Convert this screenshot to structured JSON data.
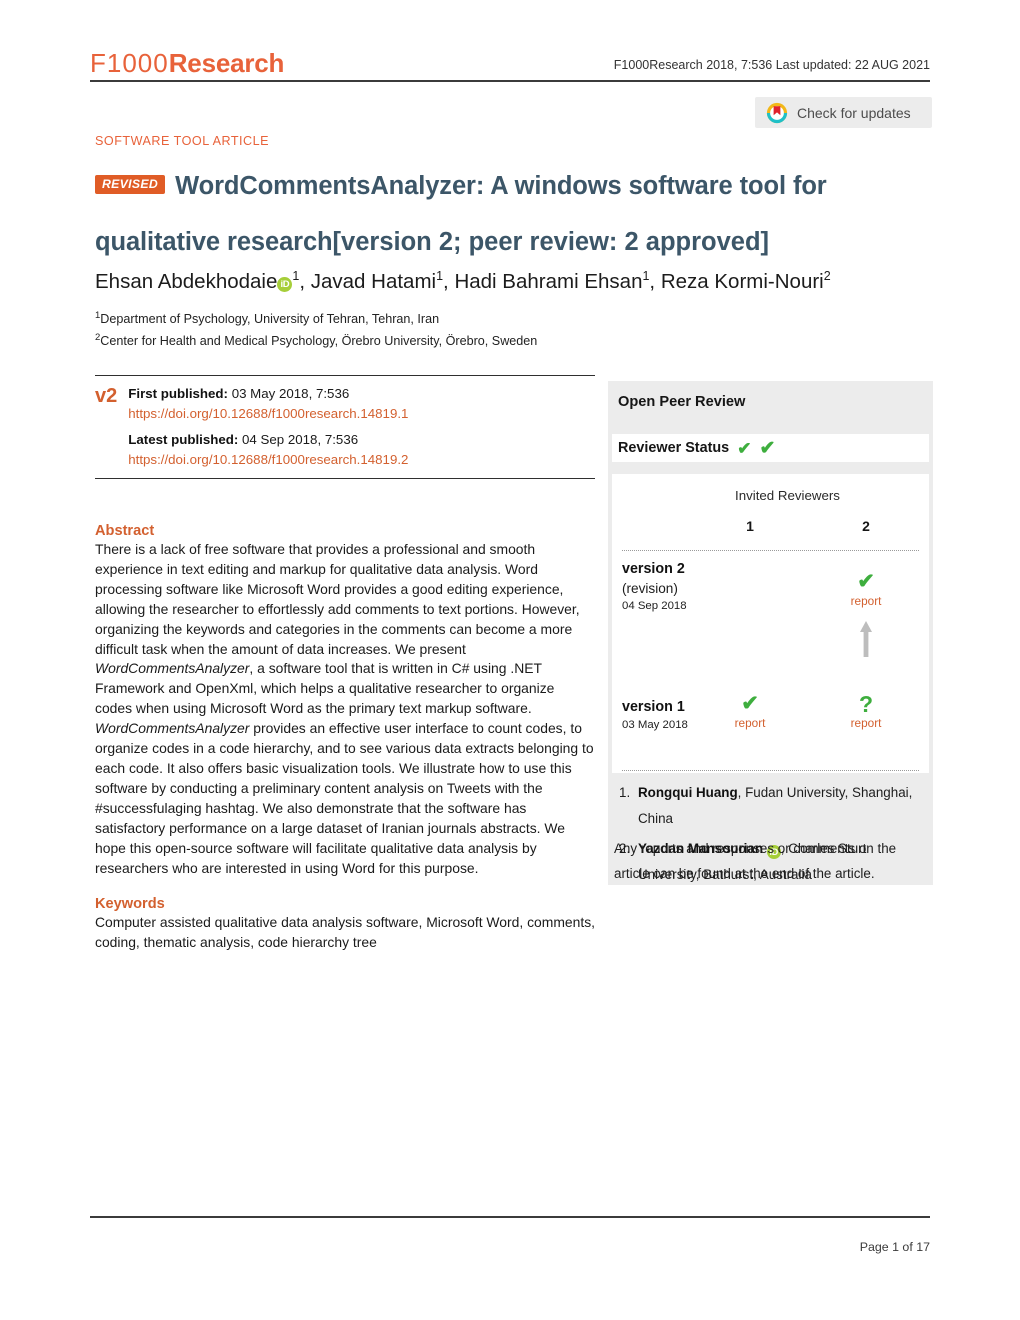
{
  "header": {
    "logo_thin": "F1000",
    "logo_bold": "Research",
    "meta": "F1000Research 2018, 7:536 Last updated: 22 AUG 2021",
    "crossmark_label": "Check for updates",
    "crossmark_icon": "crossmark-circle-bookmark-icon"
  },
  "article": {
    "type": "SOFTWARE TOOL ARTICLE",
    "revised_badge": "REVISED",
    "title_line1": "WordCommentsAnalyzer: A windows software tool for",
    "title_line2": "qualitative research",
    "title_version": "[version 2; peer review: 2 approved]",
    "authors_html": "Ehsan Abdekhodaie<ORCID><sup>1</sup>, Javad Hatami<sup>1</sup>, Hadi Bahrami Ehsan<sup>1</sup>, Reza Kormi-Nouri<sup>2</sup>",
    "affiliations": [
      {
        "marker": "1",
        "text": "Department of Psychology, University of Tehran, Tehran, Iran"
      },
      {
        "marker": "2",
        "text": "Center for Health and Medical Psychology, Örebro University, Örebro, Sweden"
      }
    ]
  },
  "publication": {
    "version_tag": "v2",
    "first_published_label": "First published:",
    "first_published_value": "03 May 2018, 7:536",
    "first_published_doi": "https://doi.org/10.12688/f1000research.14819.1",
    "latest_published_label": "Latest published:",
    "latest_published_value": "04 Sep 2018, 7:536",
    "latest_published_doi": "https://doi.org/10.12688/f1000research.14819.2"
  },
  "abstract": {
    "heading": "Abstract",
    "paragraph": "There is a lack of free software that provides a professional and smooth experience in text editing and markup for qualitative data analysis. Word processing software like Microsoft Word provides a good editing experience, allowing the researcher to effortlessly add comments to text portions. However, organizing the keywords and categories in the comments can become a more difficult task when the amount of data increases. We present WordCommentsAnalyzer, a software tool that is written in C# using .NET Framework and OpenXml, which helps a qualitative researcher to organize codes when using Microsoft Word as the primary text markup software. WordCommentsAnalyzer provides an effective user interface to count codes, to organize codes in a code hierarchy, and to see various data extracts belonging to each code. It also offers basic visualization tools. We illustrate how to use this software by conducting a preliminary content analysis on Tweets with the #successfulaging hashtag. We also demonstrate that the software has satisfactory performance on a large dataset of Iranian journals abstracts. We hope this open-source software will facilitate qualitative data analysis by researchers who are interested in using Word for this purpose."
  },
  "keywords": {
    "heading": "Keywords",
    "text": "Computer assisted qualitative data analysis software, Microsoft Word, comments, coding, thematic analysis, code hierarchy tree"
  },
  "peer_review": {
    "title": "Open Peer Review",
    "reviewer_status_label": "Reviewer Status",
    "reviewer_status_marks": [
      "check",
      "check"
    ],
    "invited_reviewers_label": "Invited Reviewers",
    "columns": [
      "1",
      "2"
    ],
    "rows": [
      {
        "name": "version 2",
        "sub": "(revision)",
        "date": "04 Sep 2018",
        "cells": [
          {
            "mark": "",
            "report": ""
          },
          {
            "mark": "✔",
            "report": "report"
          }
        ]
      },
      {
        "name": "version 1",
        "sub": "",
        "date": "03 May 2018",
        "cells": [
          {
            "mark": "✔",
            "report": "report"
          },
          {
            "mark": "?",
            "report": "report"
          }
        ]
      }
    ],
    "reviewers": [
      {
        "num": "1.",
        "name": "Rongqui Huang",
        "affil": ", Fudan University, Shanghai, China",
        "orcid": false
      },
      {
        "num": "2.",
        "name": "Yazdan Mansourian",
        "affil": ", Charles Sturt University, Bathurst, Australia",
        "orcid": true
      }
    ],
    "footnote": "Any reports and responses or comments on the article can be found at the end of the article."
  },
  "footer": {
    "page_number": "Page 1 of 17"
  },
  "colors": {
    "brand_orange": "#e8623a",
    "doi_orange": "#d3602f",
    "title_slate": "#3c5668",
    "approve_green": "#3eae3e",
    "orcid_green": "#a6ce39",
    "panel_gray": "#ececec"
  }
}
